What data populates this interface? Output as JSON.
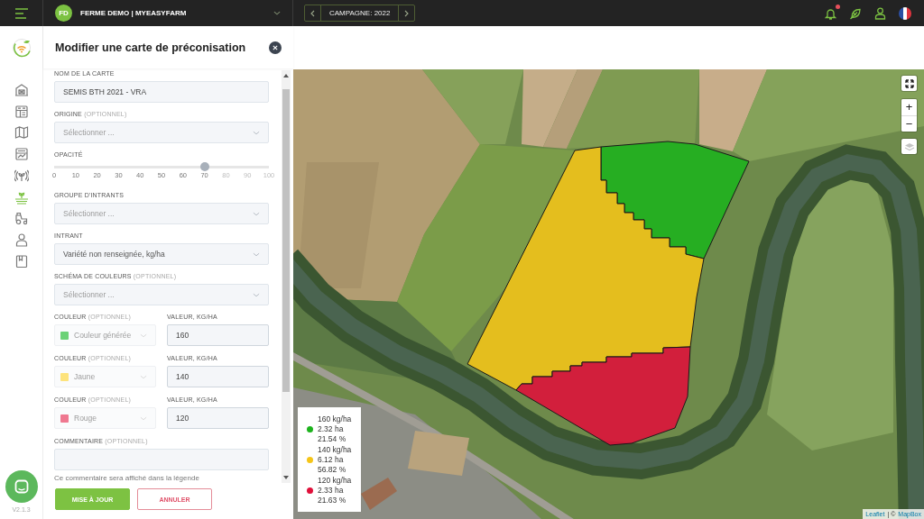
{
  "top_bar": {
    "farm": {
      "initials": "FD",
      "name": "FERME DEMO | MYEASYFARM"
    },
    "campaign": "CAMPAGNE: 2022",
    "notifications": {
      "unread": true
    }
  },
  "sidebar": {
    "items": [
      {
        "selected": false
      },
      {
        "selected": false
      },
      {
        "selected": false
      },
      {
        "selected": false
      },
      {
        "selected": false
      },
      {
        "selected": true
      },
      {
        "selected": false
      },
      {
        "selected": false
      },
      {
        "selected": false
      }
    ],
    "version": "V2.1.3"
  },
  "panel": {
    "title": "Modifier une carte de préconisation",
    "fields": [
      {
        "kind": "text",
        "label": "NOM DE LA CARTE",
        "value": "SEMIS BTH 2021 - VRA"
      },
      {
        "kind": "select",
        "label": "ORIGINE",
        "optional": "(OPTIONNEL)",
        "placeholder": "Sélectionner ..."
      },
      {
        "kind": "slider",
        "label": "OPACITÉ",
        "level": 0.7,
        "ticks": [
          "0",
          "10",
          "20",
          "30",
          "40",
          "50",
          "60",
          "70",
          "80",
          "90",
          "100"
        ]
      },
      {
        "kind": "select",
        "label": "GROUPE D'INTRANTS",
        "placeholder": "Sélectionner ..."
      },
      {
        "kind": "select",
        "label": "INTRANT",
        "value": "Variété non renseignée, kg/ha"
      },
      {
        "kind": "select",
        "label": "SCHÉMA DE COULEURS",
        "optional": "(OPTIONNEL)",
        "placeholder": "Sélectionner ..."
      },
      {
        "kind": "color_value",
        "color_label": "COULEUR",
        "color_optional": "(OPTIONNEL)",
        "color_name": "Couleur générée",
        "color": "#6cd277",
        "disabled": true,
        "value_label": "VALEUR, KG/HA",
        "value": "160"
      },
      {
        "kind": "color_value",
        "color_label": "COULEUR",
        "color_optional": "(OPTIONNEL)",
        "color_name": "Jaune",
        "color": "#fde37c",
        "disabled": true,
        "value_label": "VALEUR, KG/HA",
        "value": "140"
      },
      {
        "kind": "color_value",
        "color_label": "COULEUR",
        "color_optional": "(OPTIONNEL)",
        "color_name": "Rouge",
        "color": "#ef7890",
        "disabled": true,
        "value_label": "VALEUR, KG/HA",
        "value": "120"
      },
      {
        "kind": "textarea",
        "label": "COMMENTAIRE",
        "optional": "(OPTIONNEL)",
        "help": "Ce commentaire sera affiché dans la légende"
      }
    ],
    "buttons": [
      {
        "kind": "primary",
        "label": "MISE À JOUR"
      },
      {
        "kind": "secondary",
        "label": "ANNULER"
      }
    ]
  },
  "map": {
    "zoom": [
      "+",
      "−"
    ],
    "legend": [
      {
        "color": "#1db31d",
        "rate": "160 kg/ha",
        "area": "2.32 ha",
        "share": "21.54 %"
      },
      {
        "color": "#f5c518",
        "rate": "140 kg/ha",
        "area": "6.12 ha",
        "share": "56.82 %"
      },
      {
        "color": "#e0103a",
        "rate": "120 kg/ha",
        "area": "2.33 ha",
        "share": "21.63 %"
      }
    ],
    "attribution": [
      {
        "kind": "link",
        "text": "Leaflet"
      },
      {
        "kind": "text",
        "text": "| ©"
      },
      {
        "kind": "link",
        "text": "MapBox"
      }
    ]
  }
}
